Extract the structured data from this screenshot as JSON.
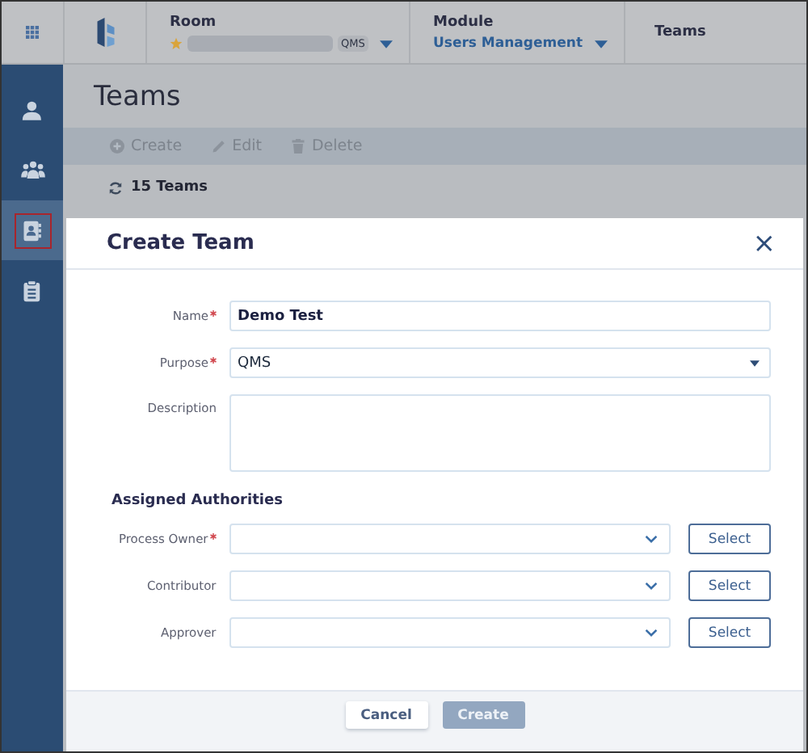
{
  "breadcrumb": {
    "room": {
      "label": "Room",
      "chip": "QMS"
    },
    "module": {
      "label": "Module",
      "value": "Users Management"
    },
    "current": "Teams"
  },
  "sidebar": {
    "items": [
      {
        "kind": "user",
        "selected": false
      },
      {
        "kind": "group",
        "selected": false
      },
      {
        "kind": "contacts",
        "selected": true
      },
      {
        "kind": "clipboard",
        "selected": false
      }
    ]
  },
  "page": {
    "title": "Teams",
    "toolbar": [
      {
        "kind": "create",
        "label": "Create"
      },
      {
        "kind": "edit",
        "label": "Edit"
      },
      {
        "kind": "delete",
        "label": "Delete"
      }
    ],
    "count": "15 Teams"
  },
  "dialog": {
    "title": "Create Team",
    "close": "×",
    "fields": [
      {
        "kind": "text",
        "label": "Name",
        "required": true,
        "value": "Demo Test"
      },
      {
        "kind": "select",
        "label": "Purpose",
        "required": true,
        "value": "QMS"
      },
      {
        "kind": "textarea",
        "label": "Description",
        "required": false
      }
    ],
    "section": "Assigned Authorities",
    "authorities": [
      {
        "label": "Process Owner",
        "required": true,
        "button": "Select"
      },
      {
        "label": "Contributor",
        "required": false,
        "button": "Select"
      },
      {
        "label": "Approver",
        "required": false,
        "button": "Select"
      }
    ],
    "buttons": [
      {
        "label": "Cancel",
        "disabled": false
      },
      {
        "label": "Create",
        "disabled": true
      }
    ]
  }
}
